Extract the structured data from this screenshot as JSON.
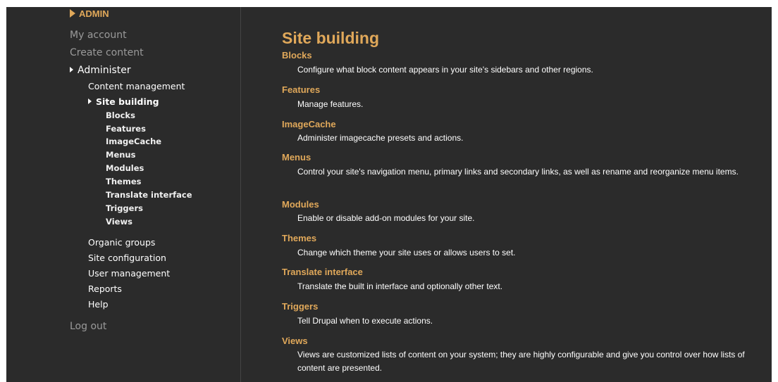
{
  "sidebar": {
    "admin_heading": "ADMIN",
    "my_account": "My account",
    "create_content": "Create content",
    "administer": "Administer",
    "admin_items": [
      {
        "label": "Content management"
      },
      {
        "label": "Site building"
      },
      {
        "label": "Organic groups"
      },
      {
        "label": "Site configuration"
      },
      {
        "label": "User management"
      },
      {
        "label": "Reports"
      },
      {
        "label": "Help"
      }
    ],
    "site_building_items": [
      {
        "label": "Blocks"
      },
      {
        "label": "Features"
      },
      {
        "label": "ImageCache"
      },
      {
        "label": "Menus"
      },
      {
        "label": "Modules"
      },
      {
        "label": "Themes"
      },
      {
        "label": "Translate interface"
      },
      {
        "label": "Triggers"
      },
      {
        "label": "Views"
      }
    ],
    "log_out": "Log out"
  },
  "main": {
    "title": "Site building",
    "items": [
      {
        "title": "Blocks",
        "description": "Configure what block content appears in your site's sidebars and other regions."
      },
      {
        "title": "Features",
        "description": "Manage features."
      },
      {
        "title": "ImageCache",
        "description": "Administer imagecache presets and actions."
      },
      {
        "title": "Menus",
        "description": "Control your site's navigation menu, primary links and secondary links, as well as rename and reorganize menu items."
      },
      {
        "title": "Modules",
        "description": "Enable or disable add-on modules for your site."
      },
      {
        "title": "Themes",
        "description": "Change which theme your site uses or allows users to set."
      },
      {
        "title": "Translate interface",
        "description": "Translate the built in interface and optionally other text."
      },
      {
        "title": "Triggers",
        "description": "Tell Drupal when to execute actions."
      },
      {
        "title": "Views",
        "description": "Views are customized lists of content on your system; they are highly configurable and give you control over how lists of content are presented."
      }
    ]
  },
  "colors": {
    "background": "#2b2b2b",
    "accent": "#e0a85a",
    "text": "#ffffff",
    "muted": "#9a9a9a"
  },
  "icons": {
    "admin": "triangle-right-icon",
    "expanded": "small-arrow-right-icon"
  }
}
